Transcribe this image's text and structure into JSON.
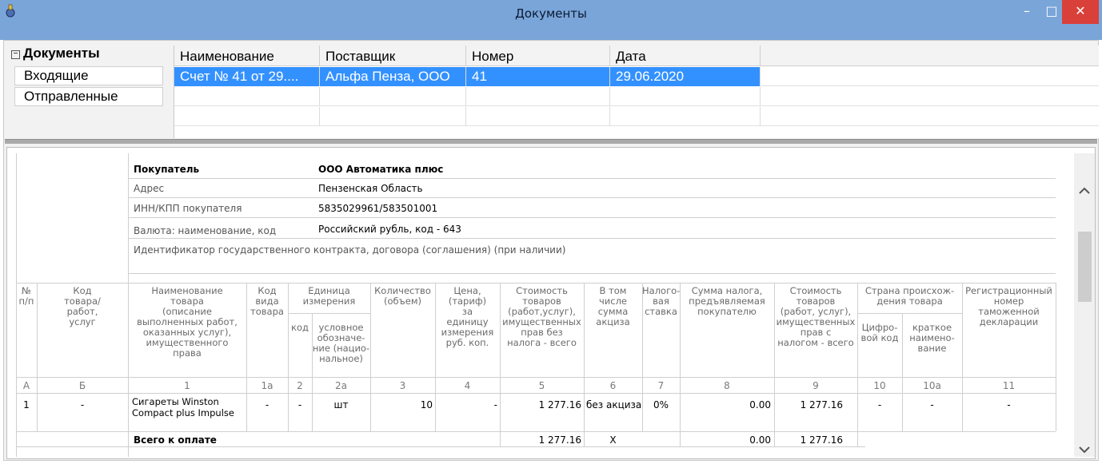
{
  "window": {
    "title": "Документы"
  },
  "tree": {
    "root_label": "Документы",
    "items": [
      "Входящие",
      "Отправленные"
    ]
  },
  "grid": {
    "columns": [
      "Наименование",
      "Поставщик",
      "Номер",
      "Дата"
    ],
    "rows": [
      {
        "name": "Счет № 41 от 29....",
        "supplier": "Альфа Пенза, ООО",
        "number": "41",
        "date": "29.06.2020"
      }
    ]
  },
  "doc": {
    "buyer_label": "Покупатель",
    "buyer_value": "ООО Автоматика плюс",
    "address_label": "Адрес",
    "address_value": "Пензенская Область",
    "inn_label": "ИНН/КПП покупателя",
    "inn_value": "5835029961/583501001",
    "currency_label": "Валюта: наименование, код",
    "currency_value": "Российский рубль, код - 643",
    "contract_label": "Идентификатор государственного контракта, договора (соглашения) (при наличии)"
  },
  "table": {
    "headers": {
      "num": "№\nп/п",
      "code": "Код\nтовара/\nработ,\nуслуг",
      "name": "Наименование\nтовара\n(описание\nвыполненных работ,\nоказанных услуг),\nимущественного\nправа",
      "kind": "Код\nвида\nтовара",
      "unit": "Единица\nизмерения",
      "unit_code": "код",
      "unit_name": "условное\nобозначе-\nние (нацио-\nнальное)",
      "qty": "Количество\n(объем)",
      "price": "Цена,\n(тариф)\nза\nединицу\nизмерения\nруб. коп.",
      "cost": "Стоимость\nтоваров\n(работ,услуг),\nимущественных\nправ без\nналога - всего",
      "excise": "В том\nчисле\nсумма\nакциза",
      "rate": "Налого-\nвая\nставка",
      "tax": "Сумма налога,\nпредъявляемая\nпокупателю",
      "total": "Стоимость\nтоваров\n(работ, услуг),\nимущественных\nправ с\nналогом - всего",
      "country": "Страна происхож-\nдения товара",
      "country_code": "Цифро-\nвой код",
      "country_name": "краткое\nнаимено-\nвание",
      "customs": "Регистрационный\nномер\nтаможенной\nдекларации"
    },
    "colnums": [
      "А",
      "Б",
      "1",
      "1а",
      "2",
      "2а",
      "3",
      "4",
      "5",
      "6",
      "7",
      "8",
      "9",
      "10",
      "10а",
      "11"
    ],
    "row": {
      "num": "1",
      "code": "-",
      "name_line1": "Сигареты Winston",
      "name_line2": "Compact plus Impulse",
      "kind": "-",
      "unit_code": "-",
      "unit_name": "шт",
      "qty": "10",
      "price": "-",
      "cost": "1 277.16",
      "excise": "без акциза",
      "rate": "0%",
      "tax": "0.00",
      "total": "1 277.16",
      "country_code": "-",
      "country_name": "-",
      "customs": "-"
    },
    "footer": {
      "label": "Всего к оплате",
      "cost": "1 277.16",
      "excise": "X",
      "tax": "0.00",
      "total": "1 277.16"
    }
  }
}
